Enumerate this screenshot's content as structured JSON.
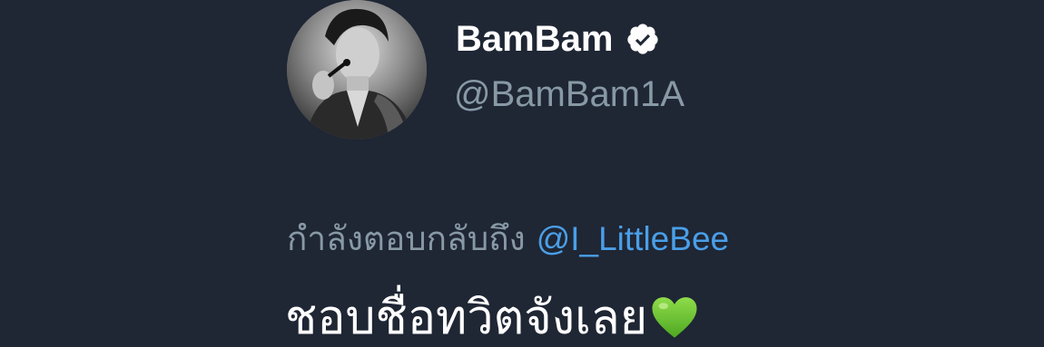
{
  "tweet": {
    "author": {
      "display_name": "BamBam",
      "handle": "@BamBam1A",
      "verified": true,
      "avatar_icon": "profile-photo"
    },
    "reply": {
      "prefix": "กำลังตอบกลับถึง",
      "mention": "@I_LittleBee"
    },
    "text": "ชอบชื่อทวิตจังเลย",
    "emoji": "green-heart-icon"
  },
  "colors": {
    "background": "#1f2634",
    "name": "#ffffff",
    "handle": "#8899a6",
    "mention": "#4a9fe8",
    "verified_badge": "#ffffff",
    "heart": "#5fbf2e"
  }
}
